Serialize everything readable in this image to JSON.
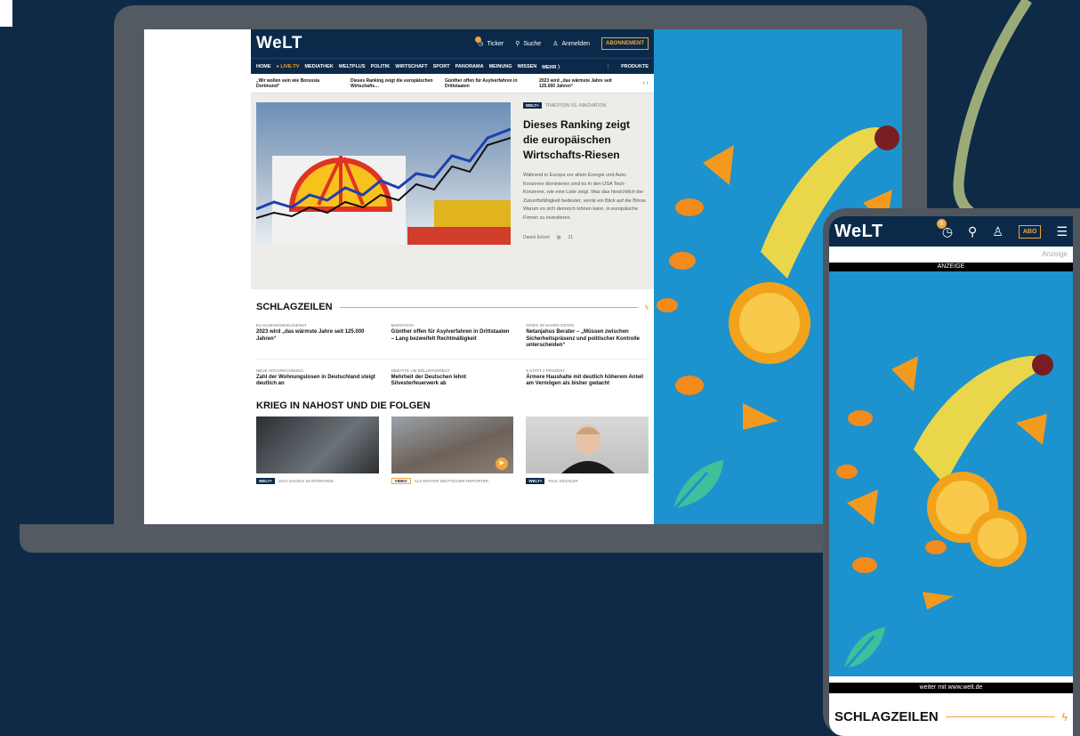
{
  "colors": {
    "background": "#0f2a47",
    "device_frame": "#535a61",
    "welt_navy": "#0b2a4a",
    "accent_orange": "#f2a33a",
    "ad_blue": "#1c92cf",
    "leaf_green": "#3fbf9a"
  },
  "laptop": {
    "header": {
      "logo": "WeLT",
      "ticker_label": "Ticker",
      "search_label": "Suche",
      "login_label": "Anmelden",
      "abo_label": "ABONNEMENT"
    },
    "nav": {
      "items": [
        "HOME",
        "● LIVE-TV",
        "MEDIATHEK",
        "WELTPLUS",
        "POLITIK",
        "WIRTSCHAFT",
        "SPORT",
        "PANORAMA",
        "MEINUNG",
        "WISSEN",
        "MEHR 〉"
      ],
      "produkte": "PRODUKTE"
    },
    "ticker": [
      "„Wir wollen sein wie Borussia Dortmund“",
      "Dieses Ranking zeigt die europäischen Wirtschafts…",
      "Günther offen für Asylverfahren in Drittstaaten",
      "2023 wird „das wärmste Jahre seit 125.000 Jahren“"
    ],
    "hero": {
      "tag": "WELT+",
      "kicker": "TRADITION VS. INNOVATION",
      "title": "Dieses Ranking zeigt die europäischen Wirtschafts-Riesen",
      "lead": "Während in Europa vor allem Energie und Auto-Konzerne dominieren sind es in den USA Tech-Konzerne, wie eine Liste zeigt. Was das hinsichtlich der Zukunftsfähigkeit bedeutet, verrät ein Blick auf die Börse. Warum es sich dennoch lohnen kann, in europäische Firmen zu investieren.",
      "author": "Daniel Eckert",
      "comments": "21"
    },
    "schlagzeilen": {
      "title": "SCHLAGZEILEN",
      "items": [
        {
          "kicker": "EU-KLIMAWANDELDIENST",
          "title": "2023 wird „das wärmste Jahre seit 125.000 Jahren“"
        },
        {
          "kicker": "MIGRATION",
          "title": "Günther offen für Asylverfahren in Drittstaaten – Lang bezweifelt Rechtmäßigkeit"
        },
        {
          "kicker": "KRIEG IM NAHEN OSTEN",
          "title": "Netanjahus Berater – „Müssen zwischen Sicherheitspräsenz und politischer Kontrolle unterscheiden“"
        },
        {
          "kicker": "NEUE HOCHRECHNUNG",
          "title": "Zahl der Wohnungslosen in Deutschland steigt deutlich an"
        },
        {
          "kicker": "DEBATTE UM BÖLLERVERBOT",
          "title": "Mehrheit der Deutschen lehnt Silvesterfeuerwerk ab"
        },
        {
          "kicker": "9 STATT 2 PROZENT",
          "title": "Ärmere Haushalte mit deutlich höherem Anteil am Vermögen als bisher gedacht"
        }
      ]
    },
    "krieg": {
      "title": "KRIEG IN NAHOST UND DIE FOLGEN",
      "cards": [
        {
          "tag": "WELT+",
          "kicker": "SHAI DAVIDAI IM INTERVIEW"
        },
        {
          "tag": "VIDEO",
          "kicker": "ALS ERSTER DEUTSCHER REPORTER"
        },
        {
          "tag": "WELT+",
          "kicker": "PAUL KESSLER"
        }
      ]
    }
  },
  "phone": {
    "logo": "WeLT",
    "ticker_count": "6",
    "abo_label": "ABO",
    "anzeige_small": "Anzeige",
    "anzeige_bar": "ANZEIGE",
    "weiter": "weiter mit www.welt.de",
    "section_title": "SCHLAGZEILEN"
  }
}
